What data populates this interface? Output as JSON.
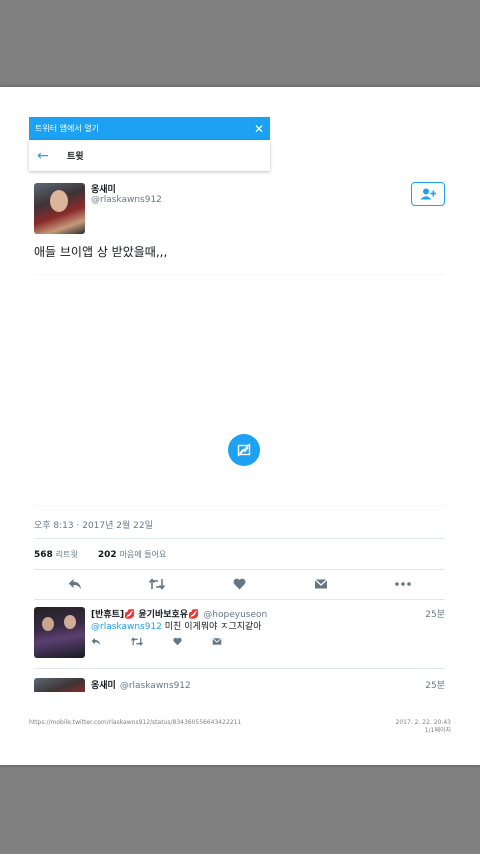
{
  "banner": {
    "text": "트위터 앱에서 열기",
    "close": "✕"
  },
  "navbar": {
    "back": "←",
    "title": "트윗"
  },
  "tweet": {
    "name": "옹새미",
    "handle": "@rlaskawns912",
    "text": "애들 브이앱 상 받았을때,,,",
    "timestamp": "오후 8:13 · 2017년 2월 22일",
    "retweet_count": "568",
    "retweet_label": "리트윗",
    "like_count": "202",
    "like_label": "마음에 들어요"
  },
  "reply": {
    "name": "[반휴트]💋 윤기바보호유💋",
    "handle": "@hopeyuseon",
    "time": "25분",
    "mention": "@rlaskawns912",
    "text": " 미친 이게뭐야 ㅈ그지같아"
  },
  "reply2": {
    "name": "옹새미",
    "handle": "@rlaskawns912",
    "time": "25분"
  },
  "footer": {
    "url": "https://mobile.twitter.com/rlaskawns912/status/834360556643422211",
    "date": "2017. 2. 22. 20:43",
    "page": "1/1페이지"
  },
  "colors": {
    "accent": "#1da1f2",
    "muted": "#657786"
  },
  "icons": {
    "close": "close-icon",
    "back": "back-arrow-icon",
    "follow": "add-user-icon",
    "media": "media-unavailable-icon",
    "reply": "reply-icon",
    "retweet": "retweet-icon",
    "like": "heart-icon",
    "dm": "direct-message-icon",
    "more": "more-icon"
  }
}
